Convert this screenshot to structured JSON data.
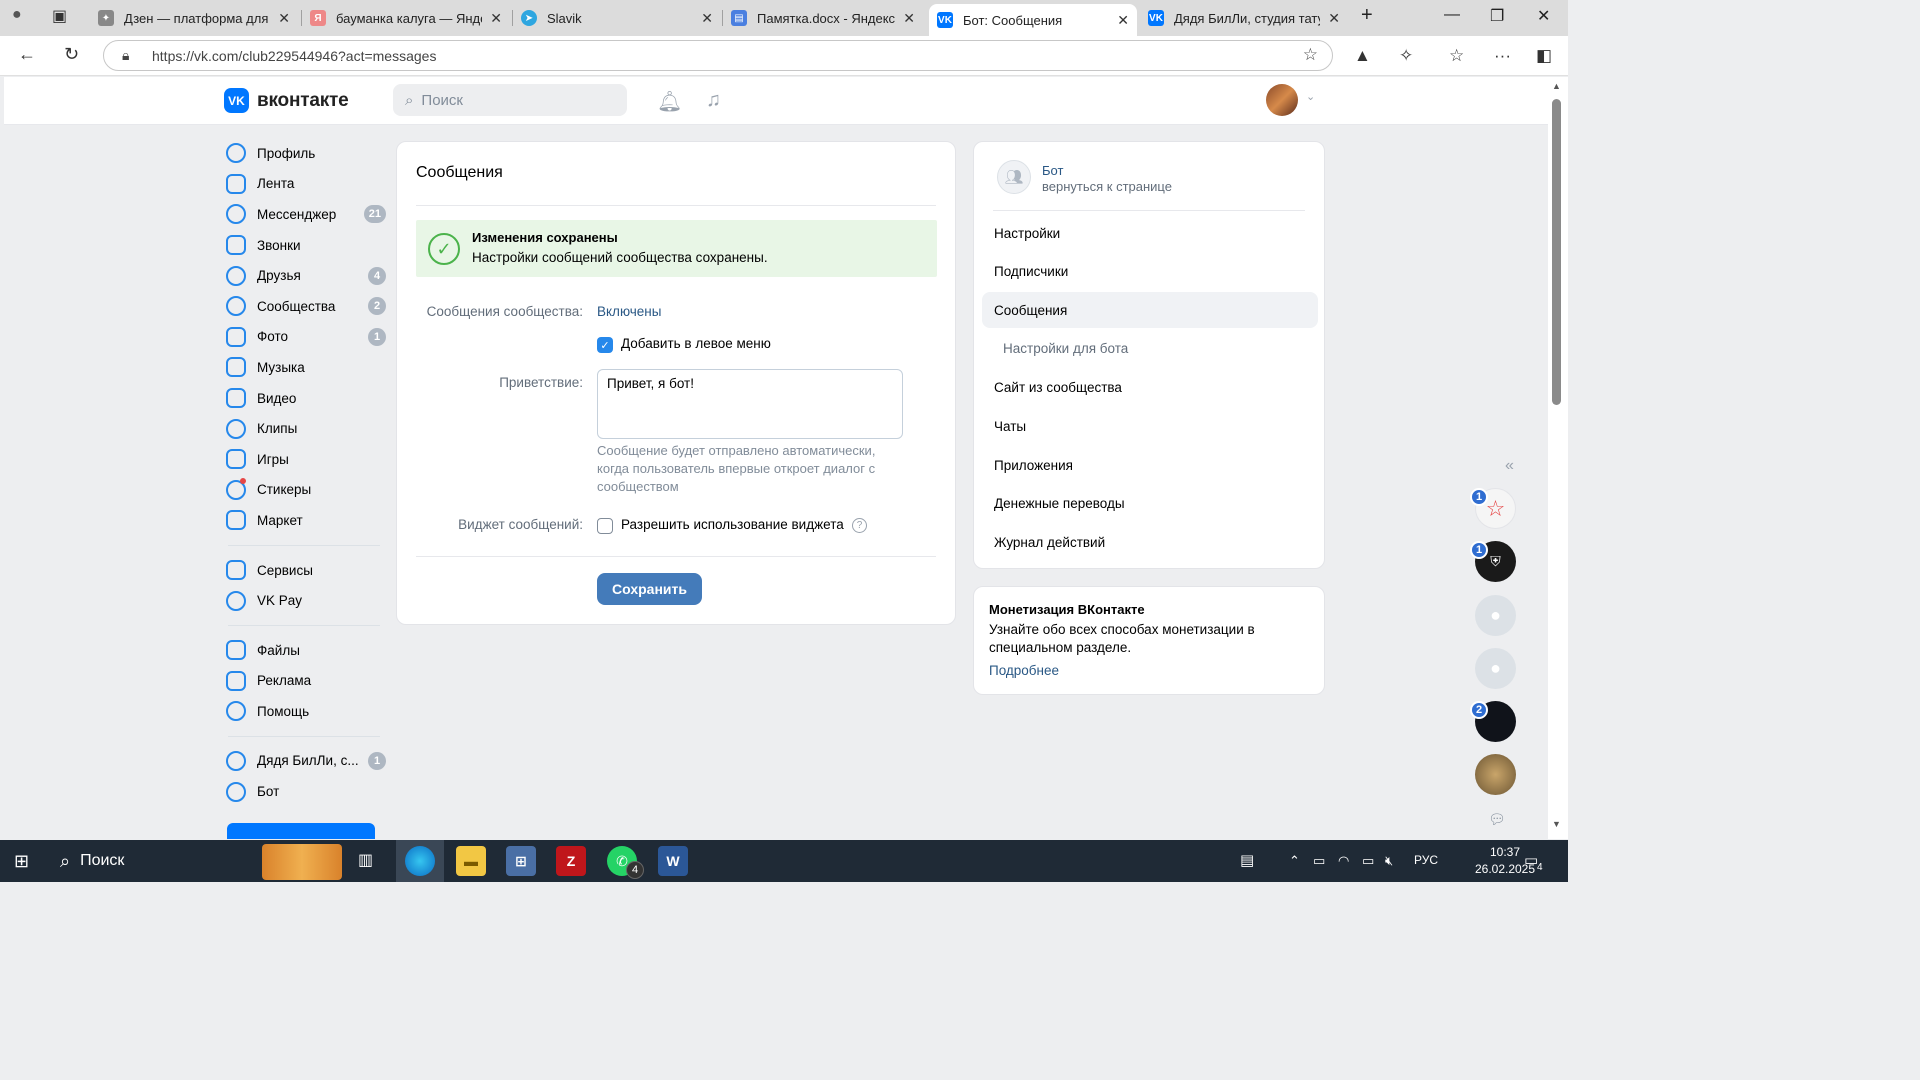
{
  "browser": {
    "tabs": [
      {
        "title": "Дзен — платформа для пр",
        "icon": "dzen-icon"
      },
      {
        "title": "бауманка калуга — Яндекс",
        "icon": "yandex-icon"
      },
      {
        "title": "Slavik",
        "icon": "telegram-icon"
      },
      {
        "title": "Памятка.docx - Яндекс До",
        "icon": "docs-icon"
      },
      {
        "title": "Бот: Сообщения",
        "icon": "vk-icon"
      },
      {
        "title": "Дядя БилЛи, студия тату, п",
        "icon": "vk-icon"
      }
    ],
    "url": "https://vk.com/club229544946?act=messages"
  },
  "vk_header": {
    "logo_mark": "VK",
    "logo_text": "вконтакте",
    "search_placeholder": "Поиск"
  },
  "left_menu": {
    "main": [
      {
        "label": "Профиль",
        "icon": "profile-icon",
        "badge": ""
      },
      {
        "label": "Лента",
        "icon": "feed-icon",
        "badge": ""
      },
      {
        "label": "Мессенджер",
        "icon": "messenger-icon",
        "badge": "21"
      },
      {
        "label": "Звонки",
        "icon": "calls-icon",
        "badge": ""
      },
      {
        "label": "Друзья",
        "icon": "friends-icon",
        "badge": "4"
      },
      {
        "label": "Сообщества",
        "icon": "communities-icon",
        "badge": "2"
      },
      {
        "label": "Фото",
        "icon": "photo-icon",
        "badge": "1"
      },
      {
        "label": "Музыка",
        "icon": "music-icon",
        "badge": ""
      },
      {
        "label": "Видео",
        "icon": "video-icon",
        "badge": ""
      },
      {
        "label": "Клипы",
        "icon": "clips-icon",
        "badge": ""
      },
      {
        "label": "Игры",
        "icon": "games-icon",
        "badge": ""
      },
      {
        "label": "Стикеры",
        "icon": "stickers-icon",
        "badge": ""
      },
      {
        "label": "Маркет",
        "icon": "market-icon",
        "badge": ""
      }
    ],
    "services": [
      {
        "label": "Сервисы",
        "icon": "services-icon",
        "badge": ""
      },
      {
        "label": "VK Pay",
        "icon": "vkpay-icon",
        "badge": ""
      }
    ],
    "extra": [
      {
        "label": "Файлы",
        "icon": "files-icon",
        "badge": ""
      },
      {
        "label": "Реклама",
        "icon": "ads-icon",
        "badge": ""
      },
      {
        "label": "Помощь",
        "icon": "help-icon",
        "badge": ""
      }
    ],
    "groups": [
      {
        "label": "Дядя БилЛи, с...",
        "icon": "group-icon",
        "badge": "1"
      },
      {
        "label": "Бот",
        "icon": "group-icon",
        "badge": ""
      }
    ]
  },
  "main": {
    "title": "Сообщения",
    "success_title": "Изменения сохранены",
    "success_text": "Настройки сообщений сообщества сохранены.",
    "messages_label": "Сообщения сообщества:",
    "messages_value": "Включены",
    "add_left_menu_label": "Добавить в левое меню",
    "add_left_menu_checked": true,
    "greeting_label": "Приветствие:",
    "greeting_value": "Привет, я бот!",
    "greeting_hint": "Сообщение будет отправлено автоматически, когда пользователь впервые откроет диалог с сообществом",
    "widget_label": "Виджет сообщений:",
    "widget_checkbox_label": "Разрешить использование виджета",
    "widget_checked": false,
    "help_glyph": "?",
    "save_label": "Сохранить"
  },
  "right_nav": {
    "bot_name": "Бот",
    "back_link": "вернуться к странице",
    "items": [
      {
        "label": "Настройки",
        "active": false,
        "sub": false
      },
      {
        "label": "Подписчики",
        "active": false,
        "sub": false
      },
      {
        "label": "Сообщения",
        "active": true,
        "sub": false
      },
      {
        "label": "Настройки для бота",
        "active": false,
        "sub": true
      },
      {
        "label": "Сайт из сообщества",
        "active": false,
        "sub": false
      },
      {
        "label": "Чаты",
        "active": false,
        "sub": false
      },
      {
        "label": "Приложения",
        "active": false,
        "sub": false
      },
      {
        "label": "Денежные переводы",
        "active": false,
        "sub": false
      },
      {
        "label": "Журнал действий",
        "active": false,
        "sub": false
      }
    ]
  },
  "monetization": {
    "title": "Монетизация ВКонтакте",
    "text": "Узнайте обо всех способах монетизации в специальном разделе.",
    "link": "Подробнее"
  },
  "chat_bubbles": [
    {
      "badge": "1",
      "kind": "star"
    },
    {
      "badge": "1",
      "kind": "dark"
    },
    {
      "badge": "",
      "kind": "gray"
    },
    {
      "badge": "",
      "kind": "gray"
    },
    {
      "badge": "2",
      "kind": "dark"
    },
    {
      "badge": "",
      "kind": "owl"
    }
  ],
  "taskbar": {
    "search_placeholder": "Поиск",
    "whatsapp_badge": "4",
    "language": "РУС",
    "time": "10:37",
    "date": "26.02.2025",
    "notifications": "4"
  },
  "colors": {
    "vk_blue": "#0077ff",
    "link": "#2a5885",
    "success_bg": "#e8f6e6",
    "save_button": "#447bba",
    "taskbar": "#1f2a36"
  }
}
